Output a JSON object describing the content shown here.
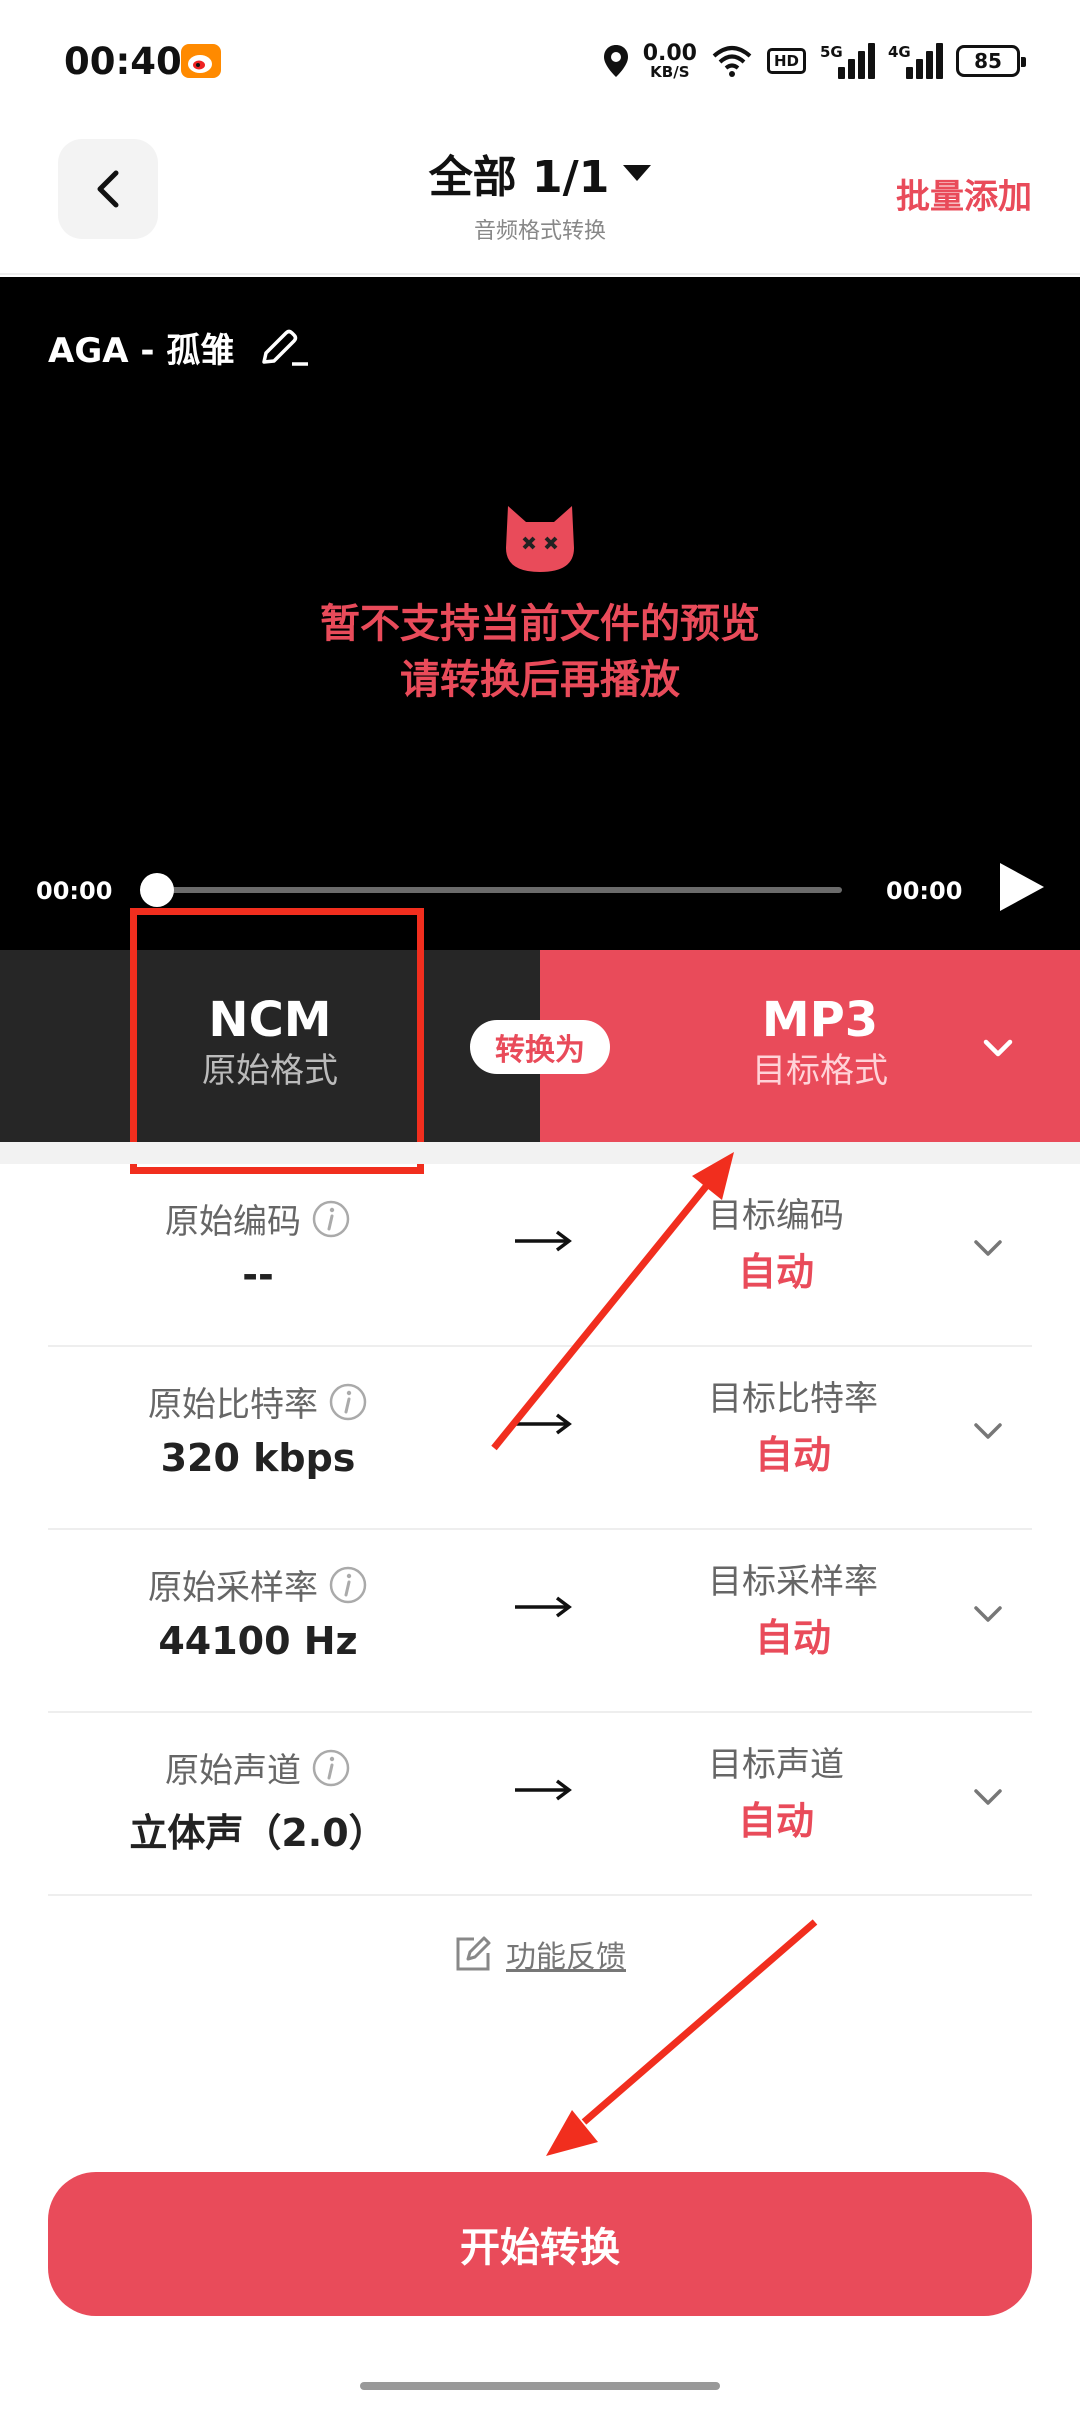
{
  "status_bar": {
    "time": "00:40",
    "net_speed_value": "0.00",
    "net_speed_unit": "KB/S",
    "hd_label": "HD",
    "sim1": "5G",
    "sim2": "4G",
    "battery": "85"
  },
  "header": {
    "title": "全部 1/1",
    "subtitle": "音频格式转换",
    "batch_add": "批量添加"
  },
  "preview": {
    "file_name": "AGA - 孤雏",
    "message_line1": "暂不支持当前文件的预览",
    "message_line2": "请转换后再播放",
    "time_current": "00:00",
    "time_total": "00:00",
    "progress": 0
  },
  "format": {
    "source_name": "NCM",
    "source_label": "原始格式",
    "convert_label": "转换为",
    "target_name": "MP3",
    "target_label": "目标格式"
  },
  "params": [
    {
      "orig_label": "原始编码",
      "orig_value": "--",
      "target_label": "目标编码",
      "target_value": "自动"
    },
    {
      "orig_label": "原始比特率",
      "orig_value": "320 kbps",
      "target_label": "目标比特率",
      "target_value": "自动"
    },
    {
      "orig_label": "原始采样率",
      "orig_value": "44100 Hz",
      "target_label": "目标采样率",
      "target_value": "自动"
    },
    {
      "orig_label": "原始声道",
      "orig_value": "立体声（2.0）",
      "target_label": "目标声道",
      "target_value": "自动"
    }
  ],
  "feedback": "功能反馈",
  "start_button": "开始转换",
  "colors": {
    "accent": "#e94b5a",
    "annotation_red": "#f12e1e",
    "dark_panel": "#262626"
  }
}
